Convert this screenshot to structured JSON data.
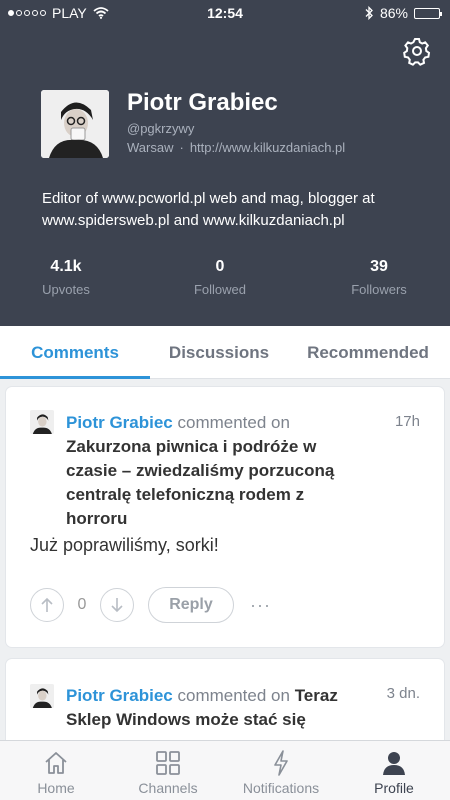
{
  "status_bar": {
    "carrier": "PLAY",
    "time": "12:54",
    "battery": "86%",
    "battery_level": 0.86
  },
  "profile": {
    "name": "Piotr Grabiec",
    "handle": "@pgkrzywy",
    "location": "Warsaw",
    "separator": "·",
    "website": "http://www.kilkuzdaniach.pl",
    "bio": "Editor of www.pcworld.pl web and mag, blogger at www.spidersweb.pl and www.kilkuzdaniach.pl",
    "icons": {
      "settings": "gear-icon",
      "avatar": "avatar"
    }
  },
  "stats": [
    {
      "value": "4.1k",
      "label": "Upvotes"
    },
    {
      "value": "0",
      "label": "Followed"
    },
    {
      "value": "39",
      "label": "Followers"
    }
  ],
  "tabs": [
    {
      "label": "Comments",
      "active": true
    },
    {
      "label": "Discussions",
      "active": false
    },
    {
      "label": "Recommended",
      "active": false
    }
  ],
  "comments": [
    {
      "author": "Piotr Grabiec",
      "verb": "commented on",
      "post_title": "Zakurzona piwnica i podróże w czasie – zwiedzaliśmy porzuconą centralę telefoniczną rodem z horroru",
      "time": "17h",
      "body": "Już poprawiliśmy, sorki!",
      "votes": "0",
      "reply_label": "Reply",
      "more_label": "···"
    },
    {
      "author": "Piotr Grabiec",
      "verb": "commented on",
      "post_title": "Teraz Sklep Windows może stać się",
      "time": "3 dn."
    }
  ],
  "bottom_nav": [
    {
      "label": "Home",
      "icon": "home-icon",
      "active": false
    },
    {
      "label": "Channels",
      "icon": "grid-icon",
      "active": false
    },
    {
      "label": "Notifications",
      "icon": "bolt-icon",
      "active": false
    },
    {
      "label": "Profile",
      "icon": "person-icon",
      "active": true
    }
  ],
  "colors": {
    "header_bg": "#3d4350",
    "accent": "#2d93d8",
    "page_bg": "#eef0f2"
  }
}
